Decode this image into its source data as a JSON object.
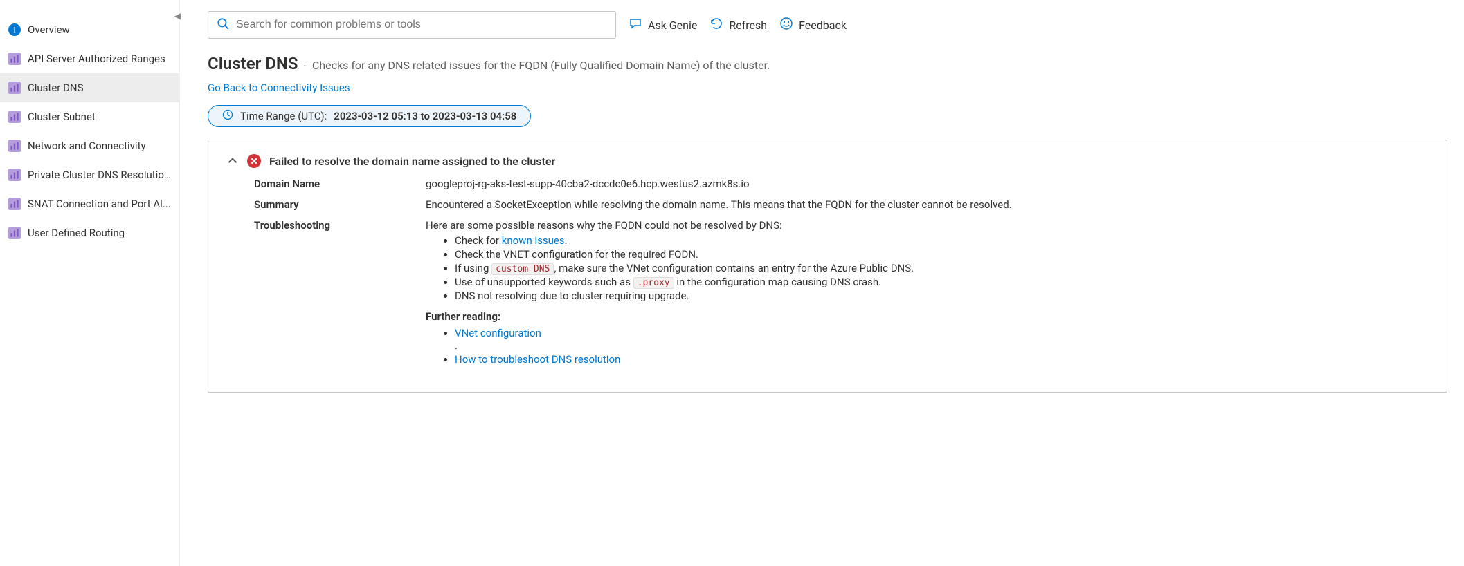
{
  "sidebar": {
    "overview": "Overview",
    "items": [
      {
        "label": "API Server Authorized Ranges"
      },
      {
        "label": "Cluster DNS",
        "selected": true
      },
      {
        "label": "Cluster Subnet"
      },
      {
        "label": "Network and Connectivity"
      },
      {
        "label": "Private Cluster DNS Resolutio..."
      },
      {
        "label": "SNAT Connection and Port Al..."
      },
      {
        "label": "User Defined Routing"
      }
    ]
  },
  "toolbar": {
    "search_placeholder": "Search for common problems or tools",
    "ask_genie": "Ask Genie",
    "refresh": "Refresh",
    "feedback": "Feedback"
  },
  "page": {
    "title": "Cluster DNS",
    "subtitle_sep": " - ",
    "subtitle": "Checks for any DNS related issues for the FQDN (Fully Qualified Domain Name) of the cluster.",
    "back_link": "Go Back to Connectivity Issues",
    "time_label": "Time Range (UTC): ",
    "time_value": "2023-03-12 05:13 to 2023-03-13 04:58"
  },
  "diagnostic": {
    "title": "Failed to resolve the domain name assigned to the cluster",
    "domain_label": "Domain Name",
    "domain_value": "googleproj-rg-aks-test-supp-40cba2-dccdc0e6.hcp.westus2.azmk8s.io",
    "summary_label": "Summary",
    "summary_value": "Encountered a SocketException while resolving the domain name. This means that the FQDN for the cluster cannot be resolved.",
    "troubleshooting_label": "Troubleshooting",
    "troubleshooting_intro": "Here are some possible reasons why the FQDN could not be resolved by DNS:",
    "ts_check_for": "Check for ",
    "ts_known_issues": "known issues",
    "ts_period": ".",
    "ts_vnet_config": "Check the VNET configuration for the required FQDN.",
    "ts_if_prefix": "If using ",
    "ts_code_custom": "custom DNS",
    "ts_if_suffix": ", make sure the VNet configuration contains an entry for the Azure Public DNS.",
    "ts_keywords_prefix": "Use of unsupported keywords such as ",
    "ts_code_proxy": ".proxy",
    "ts_keywords_suffix": " in the configuration map causing DNS crash.",
    "ts_upgrade": "DNS not resolving due to cluster requiring upgrade.",
    "further_reading_label": "Further reading:",
    "further_vnet": "VNet configuration",
    "further_dot": ".",
    "further_dns": "How to troubleshoot DNS resolution"
  }
}
